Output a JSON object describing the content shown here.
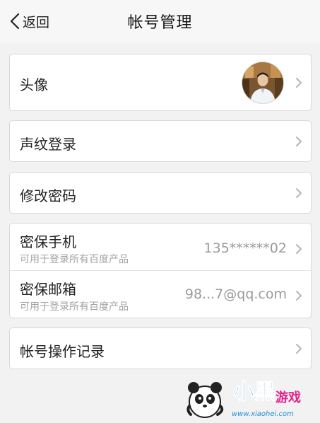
{
  "navbar": {
    "back_label": "返回",
    "title": "帐号管理"
  },
  "rows": {
    "avatar": {
      "label": "头像"
    },
    "voiceprint": {
      "label": "声纹登录"
    },
    "change_password": {
      "label": "修改密码"
    },
    "security_phone": {
      "label": "密保手机",
      "subtitle": "可用于登录所有百度产品",
      "value": "135******02"
    },
    "security_email": {
      "label": "密保邮箱",
      "subtitle": "可用于登录所有百度产品",
      "value": "98...7@qq.com"
    },
    "account_log": {
      "label": "帐号操作记录"
    }
  },
  "watermark": {
    "brand": "小黑游戏",
    "url": "www.xiaohei.com"
  },
  "colors": {
    "background": "#f2f2f2",
    "card": "#ffffff",
    "border": "#d8d8d8",
    "secondary_text": "#9b9b9b",
    "chevron": "#b5b5b5"
  }
}
